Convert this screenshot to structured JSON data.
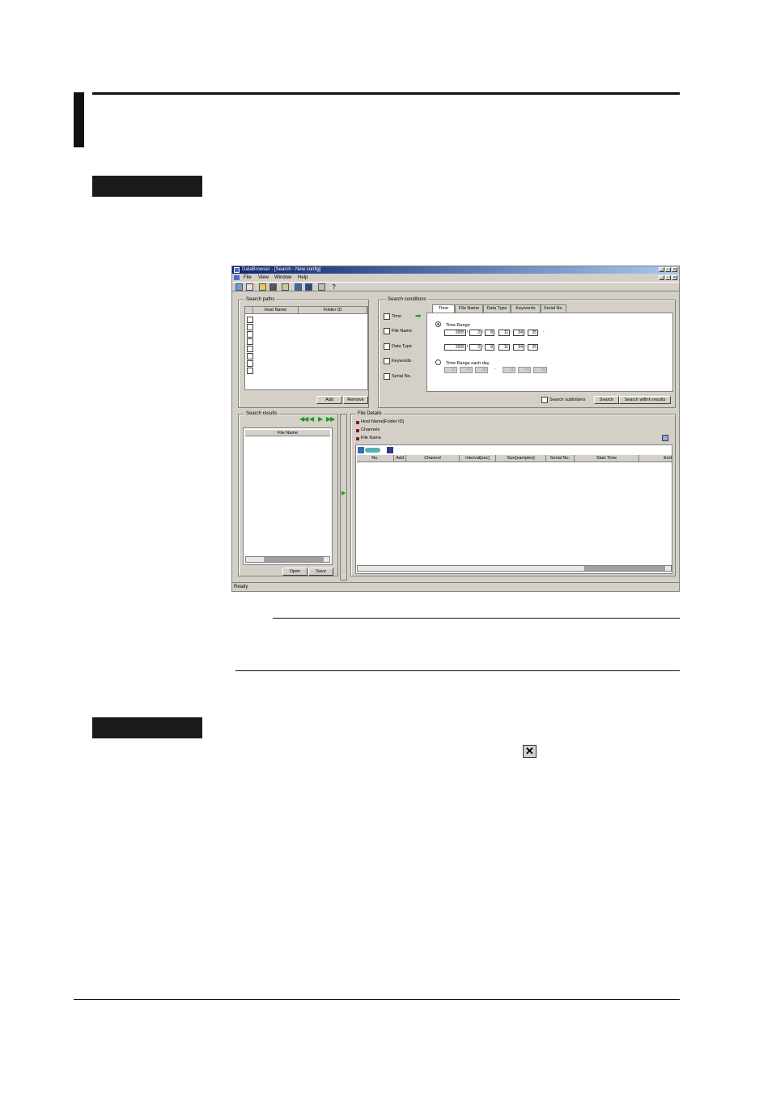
{
  "window": {
    "title": "DataBrowser - [Search - New config]",
    "status": "Ready"
  },
  "menu": [
    "File",
    "View",
    "Window",
    "Help"
  ],
  "search_paths": {
    "title": "Search paths",
    "columns": [
      "Host Name",
      "Folder ID"
    ],
    "add_label": "Add",
    "remove_label": "Remove"
  },
  "search_conditions": {
    "title": "Search conditions",
    "checks": [
      "Time",
      "File Name",
      "Data Type",
      "Keywords",
      "Serial No."
    ],
    "tabs": [
      "Time",
      "File Name",
      "Data Type",
      "Keywords",
      "Serial No."
    ],
    "time_range_label": "Time Range",
    "time_range_each_day_label": "Time Range each day",
    "from": {
      "year": "2005",
      "month": "2",
      "day": "8",
      "hour": "11",
      "minute": "04",
      "second": "25"
    },
    "to": {
      "year": "2005",
      "month": "2",
      "day": "8",
      "hour": "11",
      "minute": "04",
      "second": "25"
    },
    "each_from": {
      "hour": "11",
      "minute": "04",
      "second": "25"
    },
    "each_to": {
      "hour": "11",
      "minute": "04",
      "second": "25"
    },
    "subfolders_label": "Search subfolders",
    "search_label": "Search",
    "search_within_label": "Search within results"
  },
  "search_results": {
    "title": "Search results",
    "column": "File Name",
    "open_label": "Open",
    "save_label": "Save"
  },
  "file_details": {
    "title": "File Details",
    "items": [
      "Host Name[Folder ID]",
      "Channels",
      "File Name"
    ],
    "columns": [
      "No.",
      "Add",
      "Channel",
      "Interval[sec]",
      "Size[samples]",
      "Serial No.",
      "Start Time",
      "End"
    ]
  },
  "colors": {
    "titlebar_start": "#0a246a",
    "titlebar_end": "#a6caf0",
    "bullet": "#8b1a1a",
    "nav_arrows": "#1a9a1a"
  }
}
